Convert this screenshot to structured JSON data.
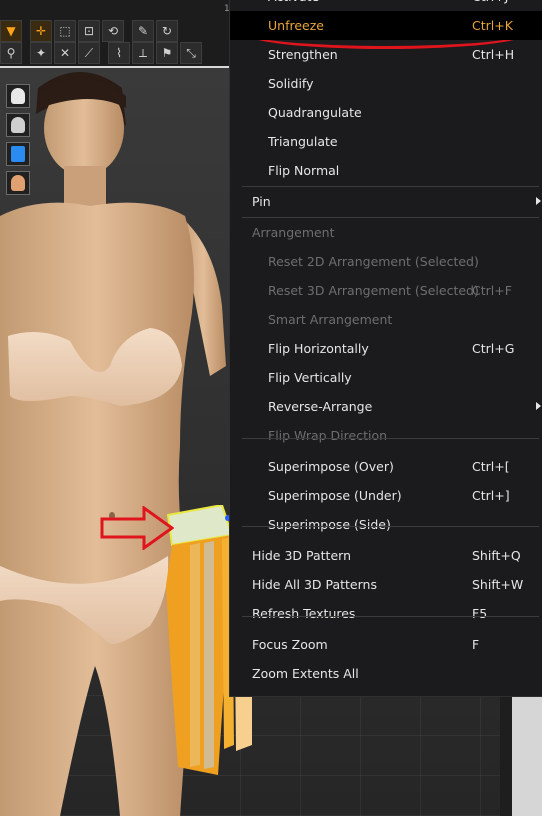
{
  "toolbar": {
    "ruler_tick": "1",
    "row1": [
      "down-arrow-icon",
      "move-icon",
      "select-box-icon",
      "edit-box-icon",
      "transform-icon",
      "pen-icon",
      "rotate-icon"
    ],
    "row2": [
      "avatar-walk-icon",
      "tack-icon",
      "tack-cross-icon",
      "fold-icon",
      "brush-icon",
      "measure-icon",
      "pin-icon",
      "arrange-icon"
    ]
  },
  "side_tools": [
    "garment-icon",
    "avatar-select-icon",
    "fabric-icon",
    "avatar-head-icon"
  ],
  "menu": {
    "items": [
      {
        "label": "Activate",
        "shortcut": "Ctrl+J",
        "indent": true,
        "disabled": false,
        "highlight": false,
        "submenu": false
      },
      {
        "label": "Unfreeze",
        "shortcut": "Ctrl+K",
        "indent": true,
        "disabled": false,
        "highlight": true,
        "submenu": false
      },
      {
        "label": "Strengthen",
        "shortcut": "Ctrl+H",
        "indent": true,
        "disabled": false,
        "highlight": false,
        "submenu": false
      },
      {
        "label": "Solidify",
        "shortcut": "",
        "indent": true,
        "disabled": false,
        "highlight": false,
        "submenu": false
      },
      {
        "label": "Quadrangulate",
        "shortcut": "",
        "indent": true,
        "disabled": false,
        "highlight": false,
        "submenu": false
      },
      {
        "label": "Triangulate",
        "shortcut": "",
        "indent": true,
        "disabled": false,
        "highlight": false,
        "submenu": false
      },
      {
        "label": "Flip Normal",
        "shortcut": "",
        "indent": true,
        "disabled": false,
        "highlight": false,
        "submenu": false
      },
      {
        "label": "Pin",
        "shortcut": "",
        "indent": false,
        "disabled": false,
        "highlight": false,
        "submenu": true
      },
      {
        "label": "Arrangement",
        "shortcut": "",
        "indent": false,
        "disabled": true,
        "highlight": false,
        "submenu": false
      },
      {
        "label": "Reset 2D Arrangement (Selected)",
        "shortcut": "",
        "indent": true,
        "disabled": true,
        "highlight": false,
        "submenu": false
      },
      {
        "label": "Reset 3D Arrangement (Selected)",
        "shortcut": "Ctrl+F",
        "indent": true,
        "disabled": true,
        "highlight": false,
        "submenu": false
      },
      {
        "label": "Smart Arrangement",
        "shortcut": "",
        "indent": true,
        "disabled": true,
        "highlight": false,
        "submenu": false
      },
      {
        "label": "Flip Horizontally",
        "shortcut": "Ctrl+G",
        "indent": true,
        "disabled": false,
        "highlight": false,
        "submenu": false
      },
      {
        "label": "Flip Vertically",
        "shortcut": "",
        "indent": true,
        "disabled": false,
        "highlight": false,
        "submenu": false
      },
      {
        "label": "Reverse-Arrange",
        "shortcut": "",
        "indent": true,
        "disabled": false,
        "highlight": false,
        "submenu": true
      },
      {
        "label": "Flip Wrap Direction",
        "shortcut": "",
        "indent": true,
        "disabled": true,
        "highlight": false,
        "submenu": false
      },
      {
        "label": "Superimpose (Over)",
        "shortcut": "Ctrl+[",
        "indent": true,
        "disabled": false,
        "highlight": false,
        "submenu": false
      },
      {
        "label": "Superimpose (Under)",
        "shortcut": "Ctrl+]",
        "indent": true,
        "disabled": false,
        "highlight": false,
        "submenu": false
      },
      {
        "label": "Superimpose (Side)",
        "shortcut": "",
        "indent": true,
        "disabled": false,
        "highlight": false,
        "submenu": false
      },
      {
        "label": "Hide 3D Pattern",
        "shortcut": "Shift+Q",
        "indent": false,
        "disabled": false,
        "highlight": false,
        "submenu": false
      },
      {
        "label": "Hide All 3D Patterns",
        "shortcut": "Shift+W",
        "indent": false,
        "disabled": false,
        "highlight": false,
        "submenu": false
      },
      {
        "label": "Refresh Textures",
        "shortcut": "F5",
        "indent": false,
        "disabled": false,
        "highlight": false,
        "submenu": false
      },
      {
        "label": "Focus Zoom",
        "shortcut": "F",
        "indent": false,
        "disabled": false,
        "highlight": false,
        "submenu": false
      },
      {
        "label": "Zoom Extents All",
        "shortcut": "",
        "indent": false,
        "disabled": false,
        "highlight": false,
        "submenu": false
      }
    ]
  },
  "colors": {
    "menu_bg": "#1b1b1d",
    "highlight_text": "#e8a53a",
    "annotation_red": "#e0141c",
    "garment_orange": "#f0a020",
    "garment_band": "#dfe8c8"
  }
}
